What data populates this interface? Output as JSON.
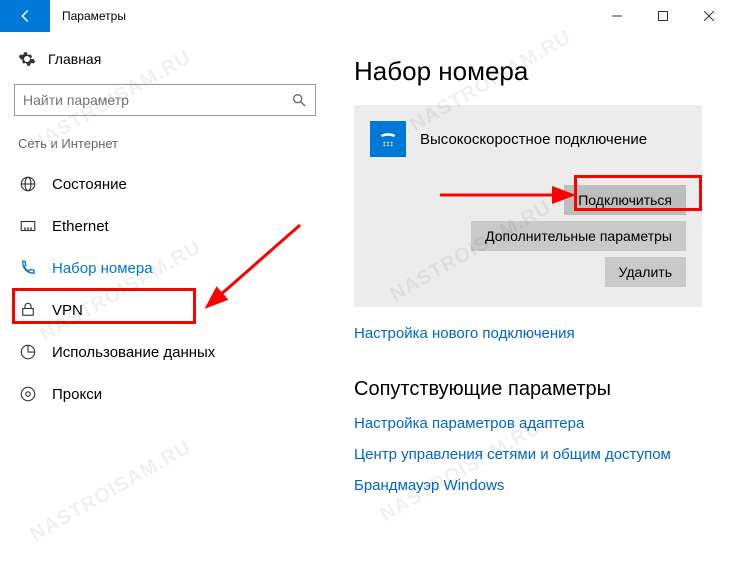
{
  "titlebar": {
    "title": "Параметры"
  },
  "sidebar": {
    "home": "Главная",
    "search_placeholder": "Найти параметр",
    "group": "Сеть и Интернет",
    "items": [
      {
        "label": "Состояние"
      },
      {
        "label": "Ethernet"
      },
      {
        "label": "Набор номера"
      },
      {
        "label": "VPN"
      },
      {
        "label": "Использование данных"
      },
      {
        "label": "Прокси"
      }
    ]
  },
  "main": {
    "heading": "Набор номера",
    "connection_name": "Высокоскоростное подключение",
    "btn_connect": "Подключиться",
    "btn_advanced": "Дополнительные параметры",
    "btn_delete": "Удалить",
    "link_setup": "Настройка нового подключения",
    "related_heading": "Сопутствующие параметры",
    "link_adapter": "Настройка параметров адаптера",
    "link_sharing": "Центр управления сетями и общим доступом",
    "link_firewall": "Брандмауэр Windows"
  },
  "watermark": "NASTROISAM.RU"
}
